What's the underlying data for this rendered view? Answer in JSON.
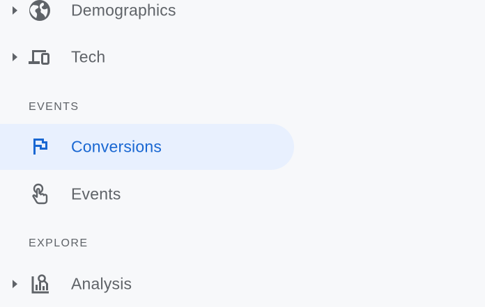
{
  "nav": {
    "items_top": [
      {
        "label": "Demographics",
        "icon": "globe-icon"
      },
      {
        "label": "Tech",
        "icon": "devices-icon"
      }
    ],
    "sections": [
      {
        "header": "EVENTS",
        "items": [
          {
            "label": "Conversions",
            "icon": "flag-icon",
            "active": true
          },
          {
            "label": "Events",
            "icon": "touch-icon"
          }
        ]
      },
      {
        "header": "EXPLORE",
        "items": [
          {
            "label": "Analysis",
            "icon": "analysis-icon"
          }
        ]
      }
    ]
  },
  "colors": {
    "background": "#f7f8fa",
    "text": "#5f6368",
    "active_bg": "#e8f0fe",
    "active_text": "#1967d2"
  }
}
